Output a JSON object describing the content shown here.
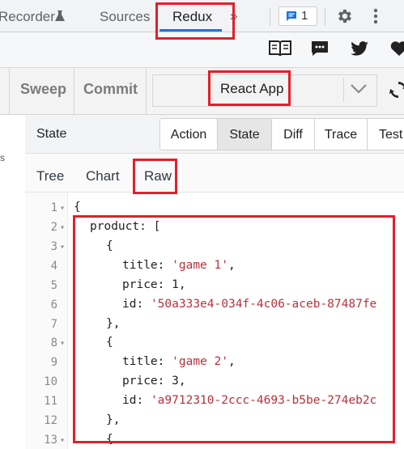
{
  "devtools_tabs": {
    "recorder": "Recorder",
    "sources": "Sources",
    "redux": "Redux",
    "issues_count": "1"
  },
  "toolbar": {
    "sweep": "Sweep",
    "commit": "Commit",
    "instance": "React App"
  },
  "state_panel": {
    "title": "State",
    "view_tabs": [
      "Action",
      "State",
      "Diff",
      "Trace",
      "Test"
    ],
    "active_view": "State",
    "sub_tabs": [
      "Tree",
      "Chart",
      "Raw"
    ],
    "active_sub_tab": "Raw"
  },
  "left_pane_fragment": "s",
  "code": {
    "line_numbers": [
      "1",
      "2",
      "3",
      "4",
      "5",
      "6",
      "7",
      "8",
      "9",
      "10",
      "11",
      "12",
      "13"
    ],
    "l1": "{",
    "l2_key": "product",
    "l2_rest": ": [",
    "l3": "{",
    "l4_key": "title",
    "l4_val": "'game 1'",
    "l5_key": "price",
    "l5_val": "1",
    "l6_key": "id",
    "l6_val": "'50a333e4-034f-4c06-aceb-87487fe",
    "l7": "},",
    "l8": "{",
    "l9_key": "title",
    "l9_val": "'game 2'",
    "l10_key": "price",
    "l10_val": "3",
    "l11_key": "id",
    "l11_val": "'a9712310-2ccc-4693-b5be-274eb2c",
    "l12": "},",
    "l13": "{"
  },
  "colors": {
    "highlight": "#e0202a",
    "accent": "#1a73e8",
    "string": "#b9313b"
  }
}
